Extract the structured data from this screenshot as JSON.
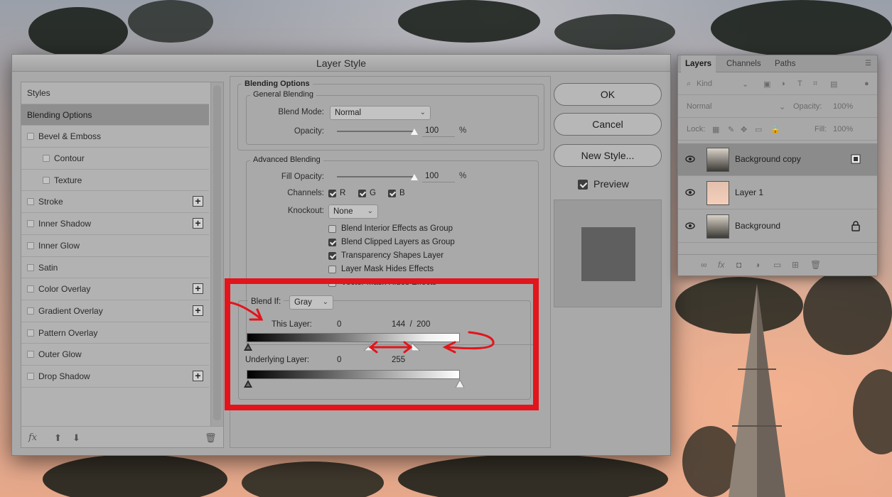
{
  "dialog": {
    "title": "Layer Style",
    "styles_header": "Styles",
    "styles": [
      {
        "label": "Blending Options",
        "checkbox": false,
        "active": true,
        "plus": false,
        "indent": false
      },
      {
        "label": "Bevel & Emboss",
        "checkbox": true,
        "active": false,
        "plus": false,
        "indent": false
      },
      {
        "label": "Contour",
        "checkbox": true,
        "active": false,
        "plus": false,
        "indent": true
      },
      {
        "label": "Texture",
        "checkbox": true,
        "active": false,
        "plus": false,
        "indent": true
      },
      {
        "label": "Stroke",
        "checkbox": true,
        "active": false,
        "plus": true,
        "indent": false
      },
      {
        "label": "Inner Shadow",
        "checkbox": true,
        "active": false,
        "plus": true,
        "indent": false
      },
      {
        "label": "Inner Glow",
        "checkbox": true,
        "active": false,
        "plus": false,
        "indent": false
      },
      {
        "label": "Satin",
        "checkbox": true,
        "active": false,
        "plus": false,
        "indent": false
      },
      {
        "label": "Color Overlay",
        "checkbox": true,
        "active": false,
        "plus": true,
        "indent": false
      },
      {
        "label": "Gradient Overlay",
        "checkbox": true,
        "active": false,
        "plus": true,
        "indent": false
      },
      {
        "label": "Pattern Overlay",
        "checkbox": true,
        "active": false,
        "plus": false,
        "indent": false
      },
      {
        "label": "Outer Glow",
        "checkbox": true,
        "active": false,
        "plus": false,
        "indent": false
      },
      {
        "label": "Drop Shadow",
        "checkbox": true,
        "active": false,
        "plus": true,
        "indent": false
      }
    ],
    "footer": {
      "fx": "fx",
      "trash_icon": "trash-icon"
    },
    "blending_options": {
      "section_title": "Blending Options",
      "general": {
        "title": "General Blending",
        "blend_mode_label": "Blend Mode:",
        "blend_mode_value": "Normal",
        "opacity_label": "Opacity:",
        "opacity_value": "100",
        "opacity_unit": "%"
      },
      "advanced": {
        "title": "Advanced Blending",
        "fill_opacity_label": "Fill Opacity:",
        "fill_opacity_value": "100",
        "fill_opacity_unit": "%",
        "channels_label": "Channels:",
        "channels": [
          "R",
          "G",
          "B"
        ],
        "knockout_label": "Knockout:",
        "knockout_value": "None",
        "options": [
          {
            "label": "Blend Interior Effects as Group",
            "checked": false
          },
          {
            "label": "Blend Clipped Layers as Group",
            "checked": true
          },
          {
            "label": "Transparency Shapes Layer",
            "checked": true
          },
          {
            "label": "Layer Mask Hides Effects",
            "checked": false
          },
          {
            "label": "Vector Mask Hides Effects",
            "checked": false
          }
        ]
      },
      "blend_if": {
        "label": "Blend If:",
        "value": "Gray",
        "this_layer_label": "This Layer:",
        "this_layer_low": "0",
        "this_layer_high": "144  /  200",
        "underlying_label": "Underlying Layer:",
        "underlying_low": "0",
        "underlying_high": "255"
      }
    },
    "buttons": {
      "ok": "OK",
      "cancel": "Cancel",
      "new_style": "New Style...",
      "preview_label": "Preview",
      "preview_checked": true
    }
  },
  "layers_panel": {
    "tabs": [
      "Layers",
      "Channels",
      "Paths"
    ],
    "filter_label": "Kind",
    "blend_mode": "Normal",
    "opacity_label": "Opacity:",
    "opacity_value": "100%",
    "lock_label": "Lock:",
    "fill_label": "Fill:",
    "fill_value": "100%",
    "layers": [
      {
        "name": "Background copy",
        "selected": true,
        "right_icon": "smart-object-icon"
      },
      {
        "name": "Layer 1",
        "selected": false,
        "right_icon": ""
      },
      {
        "name": "Background",
        "selected": false,
        "right_icon": "lock-icon"
      }
    ]
  },
  "annotation_color": "#e3141b"
}
